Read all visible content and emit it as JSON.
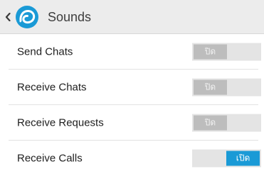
{
  "header": {
    "title": "Sounds",
    "back_icon": "chevron-left-icon",
    "logo_icon": "app-logo-icon",
    "logo_color": "#1a9ad6"
  },
  "settings": [
    {
      "label": "Send Chats",
      "toggle_text": "ปิด",
      "state": "off"
    },
    {
      "label": "Receive Chats",
      "toggle_text": "ปิด",
      "state": "off"
    },
    {
      "label": "Receive Requests",
      "toggle_text": "ปิด",
      "state": "off"
    },
    {
      "label": "Receive Calls",
      "toggle_text": "เปิด",
      "state": "on"
    }
  ],
  "colors": {
    "accent": "#1a9ad6",
    "toggle_off_knob": "#bdbdbd",
    "toggle_track": "#e4e4e4",
    "header_bg": "#ececec"
  }
}
